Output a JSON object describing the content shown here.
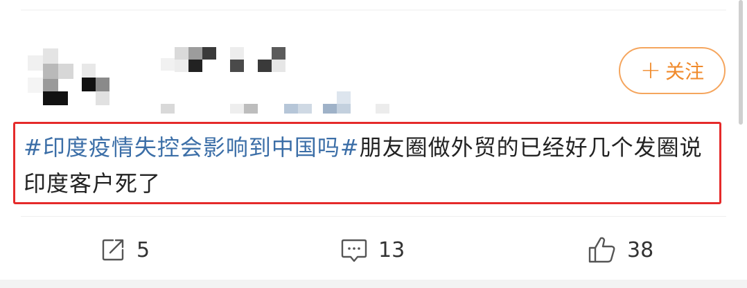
{
  "post": {
    "follow_label": "关注",
    "hashtag": "#印度疫情失控会影响到中国吗#",
    "body": "朋友圈做外贸的已经好几个发圈说印度客户死了"
  },
  "actions": {
    "repost_count": "5",
    "comment_count": "13",
    "like_count": "38"
  },
  "icons": {
    "repost": "share-icon",
    "comment": "comment-icon",
    "like": "thumbs-up-icon"
  },
  "colors": {
    "follow_accent": "#f08a2b",
    "hashtag": "#3b6ea7",
    "highlight_box": "#e52a2a"
  }
}
